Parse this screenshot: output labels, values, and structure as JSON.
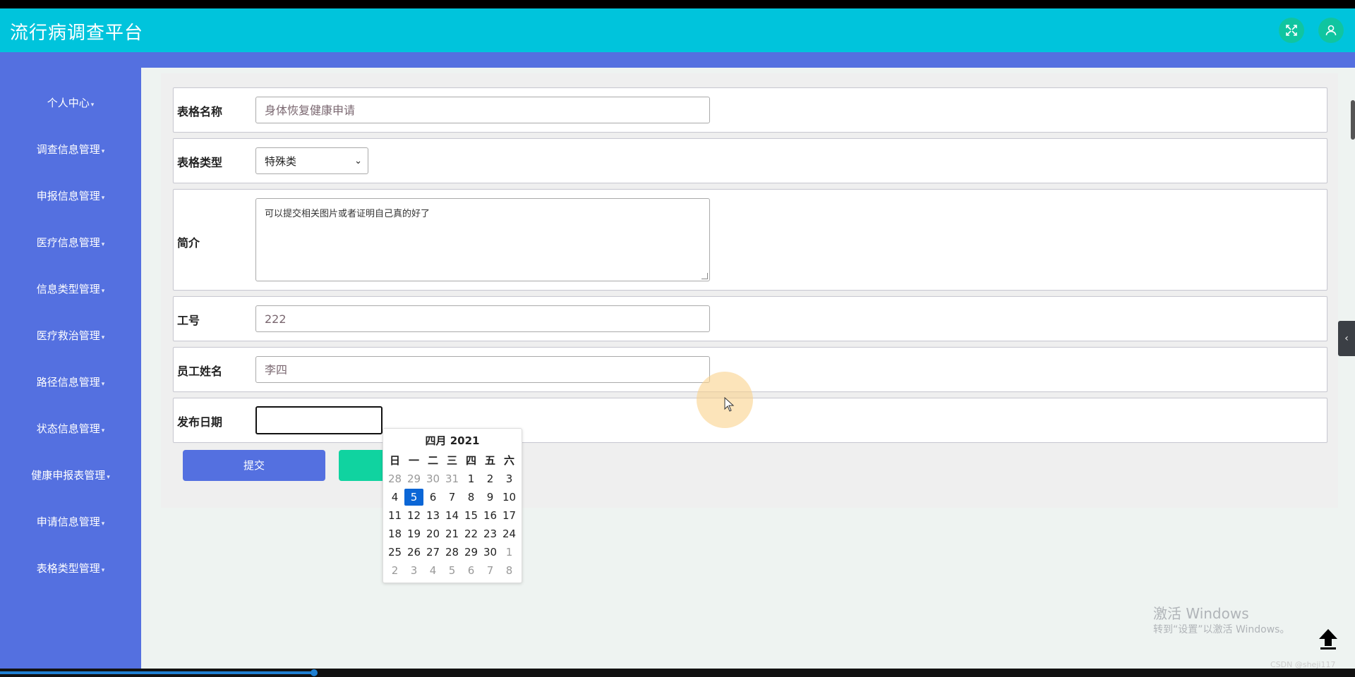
{
  "app": {
    "title": "流行病调查平台",
    "accent_color": "#00c4dc",
    "sidebar_color": "#5470e0"
  },
  "header": {
    "fullscreen_icon": "expand-icon",
    "user_icon": "user-icon"
  },
  "sidebar": {
    "items": [
      {
        "label": "个人中心"
      },
      {
        "label": "调查信息管理"
      },
      {
        "label": "申报信息管理"
      },
      {
        "label": "医疗信息管理"
      },
      {
        "label": "信息类型管理"
      },
      {
        "label": "医疗救治管理"
      },
      {
        "label": "路径信息管理"
      },
      {
        "label": "状态信息管理"
      },
      {
        "label": "健康申报表管理"
      },
      {
        "label": "申请信息管理"
      },
      {
        "label": "表格类型管理"
      }
    ]
  },
  "form": {
    "name_label": "表格名称",
    "name_value": "身体恢复健康申请",
    "type_label": "表格类型",
    "type_value": "特殊类",
    "intro_label": "简介",
    "intro_value": "可以提交相关图片或者证明自己真的好了",
    "job_no_label": "工号",
    "job_no_value": "222",
    "employee_label": "员工姓名",
    "employee_value": "李四",
    "date_label": "发布日期",
    "date_value": "",
    "submit_label": "提交",
    "reset_label": ""
  },
  "calendar": {
    "title": "四月 2021",
    "weekdays": [
      "日",
      "一",
      "二",
      "三",
      "四",
      "五",
      "六"
    ],
    "weeks": [
      [
        "28",
        "29",
        "30",
        "31",
        "1",
        "2",
        "3"
      ],
      [
        "4",
        "5",
        "6",
        "7",
        "8",
        "9",
        "10"
      ],
      [
        "11",
        "12",
        "13",
        "14",
        "15",
        "16",
        "17"
      ],
      [
        "18",
        "19",
        "20",
        "21",
        "22",
        "23",
        "24"
      ],
      [
        "25",
        "26",
        "27",
        "28",
        "29",
        "30",
        "1"
      ],
      [
        "2",
        "3",
        "4",
        "5",
        "6",
        "7",
        "8"
      ]
    ],
    "selected": "5"
  },
  "watermark": {
    "line1": "激活 Windows",
    "line2": "转到“设置”以激活 Windows。"
  },
  "credit": "CSDN @sheji117"
}
